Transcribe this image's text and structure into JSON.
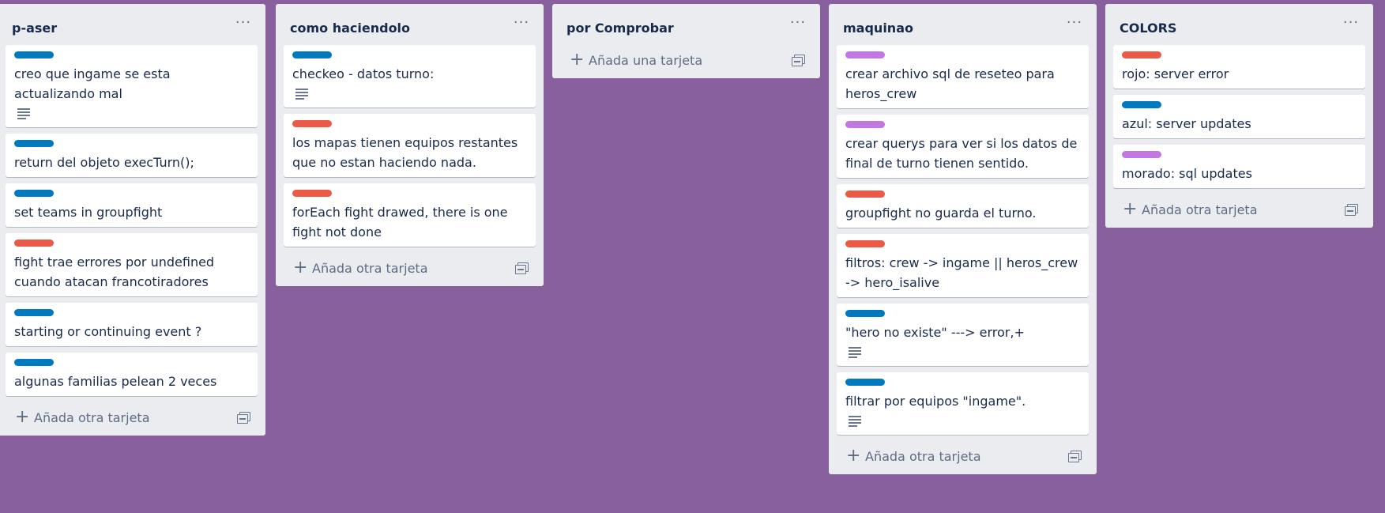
{
  "colors": {
    "board_background": "#89609e",
    "list_background": "#ebecf0",
    "label_blue": "#0079bf",
    "label_red": "#eb5a46",
    "label_purple": "#c377e0"
  },
  "icons": {
    "list_menu": "ellipsis-icon",
    "add": "plus-icon",
    "template": "card-template-icon",
    "description": "description-icon"
  },
  "list_menu_glyph": "···",
  "add_glyph": "+",
  "lists": [
    {
      "title": "p-aser",
      "add_label": "Añada otra tarjeta",
      "cards": [
        {
          "label": "blue",
          "title": "creo que ingame se esta actualizando mal",
          "has_description": true
        },
        {
          "label": "blue",
          "title": "return del objeto execTurn();",
          "has_description": false
        },
        {
          "label": "blue",
          "title": "set teams in groupfight",
          "has_description": false
        },
        {
          "label": "red",
          "title": "fight trae errores por undefined cuando atacan francotiradores",
          "has_description": false
        },
        {
          "label": "blue",
          "title": "starting or continuing event ?",
          "has_description": false
        },
        {
          "label": "blue",
          "title": "algunas familias pelean 2 veces",
          "has_description": false
        }
      ]
    },
    {
      "title": "como haciendolo",
      "add_label": "Añada otra tarjeta",
      "cards": [
        {
          "label": "blue",
          "title": "checkeo - datos turno:",
          "has_description": true
        },
        {
          "label": "red",
          "title": "los mapas tienen equipos restantes que no estan haciendo nada.",
          "has_description": false
        },
        {
          "label": "red",
          "title": "forEach fight drawed, there is one fight not done",
          "has_description": false
        }
      ]
    },
    {
      "title": "por Comprobar",
      "add_label": "Añada una tarjeta",
      "cards": []
    },
    {
      "title": "maquinao",
      "add_label": "Añada otra tarjeta",
      "cards": [
        {
          "label": "purple",
          "title": "crear archivo sql de reseteo para heros_crew",
          "has_description": false
        },
        {
          "label": "purple",
          "title": "crear querys para ver si los datos de final de turno tienen sentido.",
          "has_description": false
        },
        {
          "label": "red",
          "title": "groupfight no guarda el turno.",
          "has_description": false
        },
        {
          "label": "red",
          "title": "filtros: crew -> ingame || heros_crew -> hero_isalive",
          "has_description": false
        },
        {
          "label": "blue",
          "title": "\"hero no existe\" ---> error,+",
          "has_description": true
        },
        {
          "label": "blue",
          "title": "filtrar por equipos \"ingame\".",
          "has_description": true
        }
      ]
    },
    {
      "title": "COLORS",
      "add_label": "Añada otra tarjeta",
      "cards": [
        {
          "label": "red",
          "title": "rojo: server error",
          "has_description": false
        },
        {
          "label": "blue",
          "title": "azul: server updates",
          "has_description": false
        },
        {
          "label": "purple",
          "title": "morado: sql updates",
          "has_description": false
        }
      ]
    }
  ]
}
